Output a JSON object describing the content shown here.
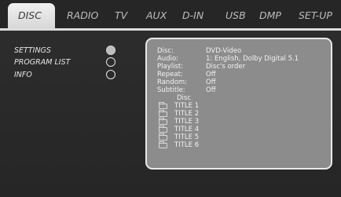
{
  "tabs": [
    {
      "label": "DISC",
      "active": true
    },
    {
      "label": "RADIO",
      "active": false
    },
    {
      "label": "TV",
      "active": false
    },
    {
      "label": "AUX",
      "active": false
    },
    {
      "label": "D-IN",
      "active": false
    },
    {
      "label": "USB",
      "active": false
    },
    {
      "label": "DMP",
      "active": false
    },
    {
      "label": "SET-UP",
      "active": false
    }
  ],
  "menu": {
    "items": [
      {
        "label": "SETTINGS",
        "selected": true
      },
      {
        "label": "PROGRAM LIST",
        "selected": false
      },
      {
        "label": "INFO",
        "selected": false
      }
    ]
  },
  "info": {
    "rows": [
      {
        "label": "Disc:",
        "value": "DVD-Video"
      },
      {
        "label": "Audio:",
        "value": "1: English, Dolby Digital 5.1"
      },
      {
        "label": "Playlist:",
        "value": "Disc's order"
      },
      {
        "label": "Repeat:",
        "value": "Off"
      },
      {
        "label": "Random:",
        "value": "Off"
      },
      {
        "label": "Subtitle:",
        "value": "Off"
      }
    ],
    "disc_header": "Disc",
    "titles": [
      "TITLE 1",
      "TITLE 2",
      "TITLE 3",
      "TITLE 4",
      "TITLE 5",
      "TITLE 6"
    ]
  },
  "colors": {
    "background": "#2b2b2b",
    "active_tab": "#e6e6e6",
    "panel": "#8c8c8c",
    "text": "#e6e6e6"
  }
}
